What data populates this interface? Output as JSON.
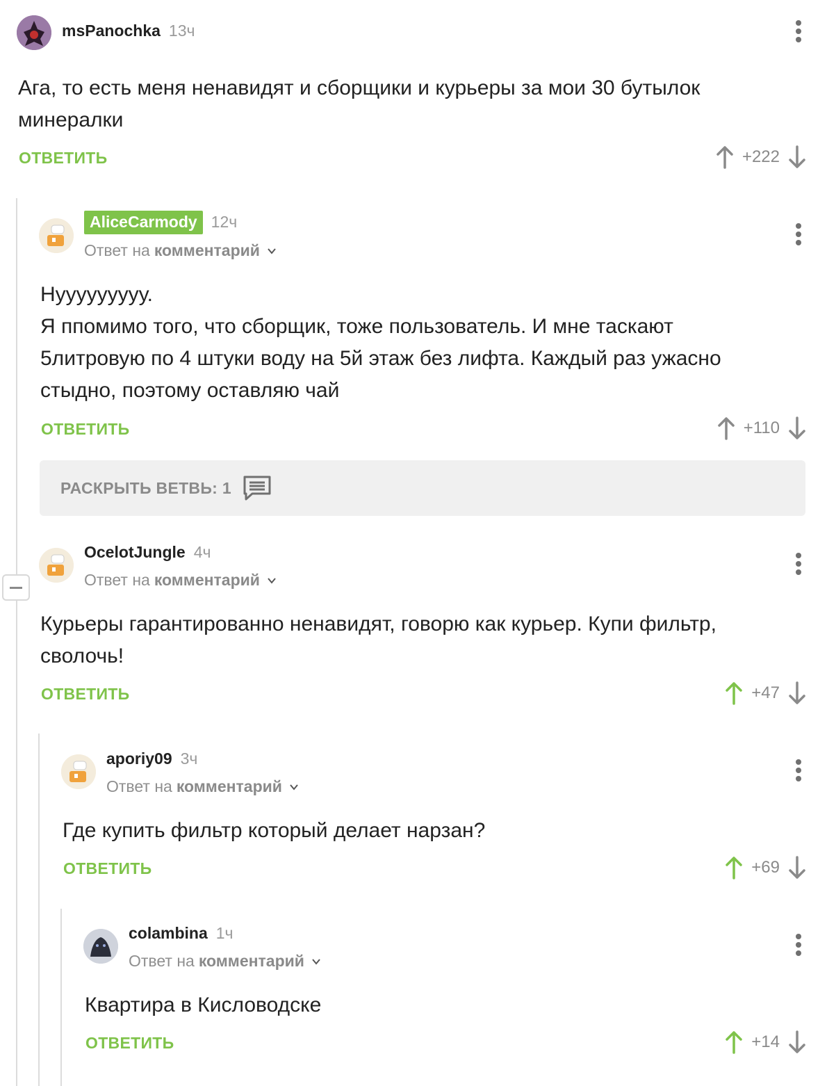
{
  "comments": [
    {
      "author": "msPanochka",
      "time": "13ч",
      "reply_prefix": "",
      "reply_target": "",
      "text": [
        "Ага, то есть меня ненавидят и сборщики и курьеры за мои 30 бутылок",
        "минералки"
      ],
      "reply_label": "ОТВЕТИТЬ",
      "score": "+222",
      "upvoted": false
    },
    {
      "author": "AliceCarmody",
      "time": "12ч",
      "reply_prefix": "Ответ на",
      "reply_target": "комментарий",
      "text": [
        "Нууууууууу.",
        "Я ппомимо того, что сборщик, тоже пользователь. И мне таскают",
        "5литровую по 4 штуки воду на 5й этаж без лифта. Каждый раз ужасно",
        "стыдно, поэтому оставляю чай"
      ],
      "reply_label": "ОТВЕТИТЬ",
      "score": "+110",
      "upvoted": false
    },
    {
      "author": "OcelotJungle",
      "time": "4ч",
      "reply_prefix": "Ответ на",
      "reply_target": "комментарий",
      "text": [
        "Курьеры гарантированно ненавидят, говорю как курьер. Купи фильтр,",
        "сволочь!"
      ],
      "reply_label": "ОТВЕТИТЬ",
      "score": "+47",
      "upvoted": true
    },
    {
      "author": "aporiy09",
      "time": "3ч",
      "reply_prefix": "Ответ на",
      "reply_target": "комментарий",
      "text": [
        "Где купить фильтр который делает нарзан?"
      ],
      "reply_label": "ОТВЕТИТЬ",
      "score": "+69",
      "upvoted": true
    },
    {
      "author": "colambina",
      "time": "1ч",
      "reply_prefix": "Ответ на",
      "reply_target": "комментарий",
      "text": [
        "Квартира в Кисловодске"
      ],
      "reply_label": "ОТВЕТИТЬ",
      "score": "+14",
      "upvoted": true
    }
  ],
  "expand_branch": {
    "label": "РАСКРЫТЬ ВЕТВЬ: 1",
    "icon": "comments-icon"
  },
  "colors": {
    "accent": "#7fc34a",
    "muted": "#8a8a8a",
    "thread_line": "#dcdcdc",
    "expand_bg": "#f0f0f0"
  },
  "icons": {
    "menu": "more-vertical-icon",
    "upvote": "arrow-up-icon",
    "downvote": "arrow-down-icon",
    "chevron": "chevron-down-icon",
    "collapse": "minus-icon"
  }
}
